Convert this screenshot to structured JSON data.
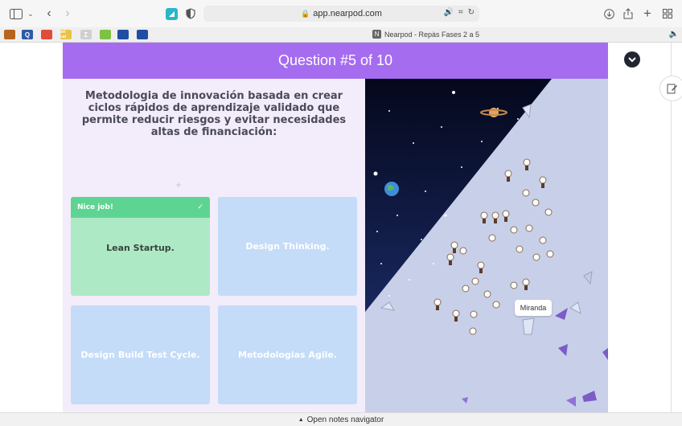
{
  "browser": {
    "url": "app.nearpod.com",
    "tab_title": "Nearpod - Repàs Fases 2 a 5",
    "tab_favicon_letter": "N",
    "favorites": [
      {
        "icon": "shield-crest-icon",
        "label": "",
        "color": "#b5651d"
      },
      {
        "icon": "q-icon",
        "label": "Q",
        "color": "#2d5aa6"
      },
      {
        "icon": "pdf-icon",
        "label": "",
        "color": "#e04b3a"
      },
      {
        "icon": "pri-cat-icon",
        "label": "pri cat",
        "color": "#e8c24a"
      },
      {
        "icon": "formula-icon",
        "label": "Σ",
        "color": "#cfcfcf"
      },
      {
        "icon": "green-box-icon",
        "label": "",
        "color": "#7dc242"
      },
      {
        "icon": "eu-flag-icon",
        "label": "",
        "color": "#1f4ea3"
      },
      {
        "icon": "eu-flag-icon",
        "label": "",
        "color": "#1f4ea3"
      }
    ]
  },
  "lesson": {
    "header": "Question #5 of 10",
    "question": "Metodologia de innovación basada en crear ciclos rápidos de aprendizaje validado que permite reducir riesgos y evitar necesidades altas de financiación:",
    "feedback": "Nice job!",
    "answers": [
      {
        "label": "Lean Startup.",
        "state": "correct"
      },
      {
        "label": "Design Thinking.",
        "state": "default"
      },
      {
        "label": "Design Build Test Cycle.",
        "state": "default"
      },
      {
        "label": "Metodologias Agile.",
        "state": "default"
      }
    ],
    "player_tooltip": "Miranda"
  },
  "bottom": {
    "notes_label": "Open notes navigator"
  },
  "colors": {
    "header": "#a56cf0",
    "correct_banner": "#5ed493",
    "correct_bg": "#aee9c6",
    "answer_bg": "#c4dcf8",
    "space": "#0b1230"
  }
}
